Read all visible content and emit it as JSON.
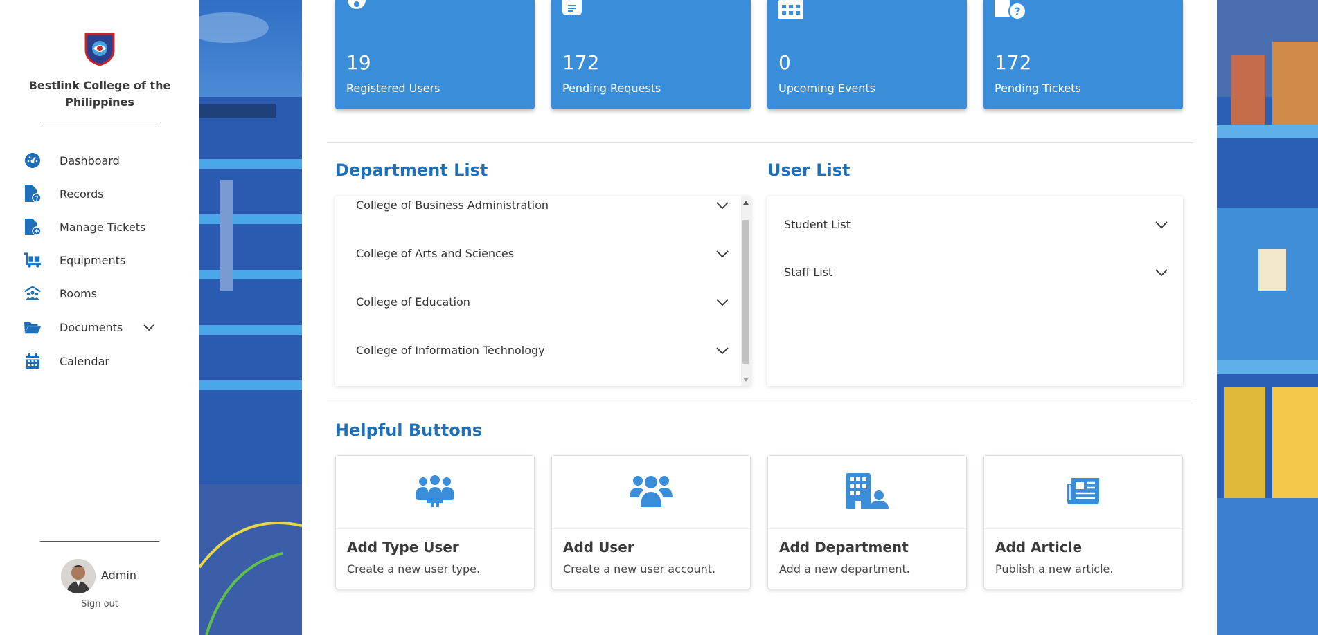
{
  "sidebar": {
    "school_name": "Bestlink College of the Philippines",
    "nav": [
      {
        "label": "Dashboard",
        "icon": "dashboard-gauge-icon"
      },
      {
        "label": "Records",
        "icon": "file-question-icon"
      },
      {
        "label": "Manage Tickets",
        "icon": "file-plus-icon"
      },
      {
        "label": "Equipments",
        "icon": "dolly-icon"
      },
      {
        "label": "Rooms",
        "icon": "people-roof-icon"
      },
      {
        "label": "Documents",
        "icon": "folder-open-icon"
      },
      {
        "label": "Calendar",
        "icon": "calendar-icon"
      }
    ],
    "user": {
      "name": "Admin",
      "signout": "Sign out"
    }
  },
  "stats": [
    {
      "value": "19",
      "label": "Registered Users",
      "icon": "user-circle-icon"
    },
    {
      "value": "172",
      "label": "Pending Requests",
      "icon": "file-lines-icon"
    },
    {
      "value": "0",
      "label": "Upcoming Events",
      "icon": "calendar-icon"
    },
    {
      "value": "172",
      "label": "Pending Tickets",
      "icon": "file-question-icon"
    }
  ],
  "departments": {
    "title": "Department List",
    "items": [
      "College of Business Administration",
      "College of Arts and Sciences",
      "College of Education",
      "College of Information Technology"
    ]
  },
  "users": {
    "title": "User List",
    "items": [
      "Student List",
      "Staff List"
    ]
  },
  "helpful": {
    "title": "Helpful Buttons",
    "cards": [
      {
        "title": "Add Type User",
        "desc": "Create a new user type.",
        "icon": "people-group-icon"
      },
      {
        "title": "Add User",
        "desc": "Create a new user account.",
        "icon": "users-icon"
      },
      {
        "title": "Add Department",
        "desc": "Add a new department.",
        "icon": "building-user-icon"
      },
      {
        "title": "Add Article",
        "desc": "Publish a new article.",
        "icon": "newspaper-icon"
      }
    ]
  },
  "colors": {
    "accent": "#3a8dd9",
    "title": "#1f6fb8",
    "nav_icon": "#1f6fb8"
  }
}
